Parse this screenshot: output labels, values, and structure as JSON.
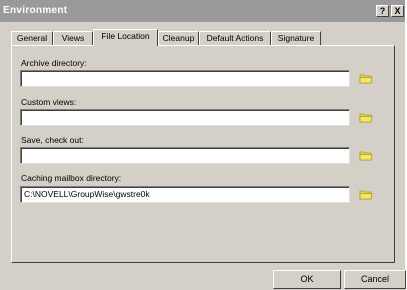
{
  "window": {
    "title": "Environment",
    "help_label": "?",
    "close_label": "X"
  },
  "tabs": [
    {
      "label": "General",
      "active": false
    },
    {
      "label": "Views",
      "active": false
    },
    {
      "label": "File Location",
      "active": true
    },
    {
      "label": "Cleanup",
      "active": false
    },
    {
      "label": "Default Actions",
      "active": false
    },
    {
      "label": "Signature",
      "active": false
    }
  ],
  "fields": [
    {
      "label": "Archive directory:",
      "value": "",
      "icon": "folder-icon"
    },
    {
      "label": "Custom views:",
      "value": "",
      "icon": "folder-icon"
    },
    {
      "label": "Save, check out:",
      "value": "",
      "icon": "folder-icon"
    },
    {
      "label": "Caching mailbox directory:",
      "value": "C:\\NOVELL\\GroupWise\\gwstre0k",
      "icon": "folder-icon"
    }
  ],
  "buttons": {
    "ok_label": "OK",
    "cancel_label": "Cancel"
  },
  "colors": {
    "dialog_bg": "#d4d0c8",
    "titlebar": "#9a9a9a",
    "folder_icon": "#e8d84a"
  }
}
